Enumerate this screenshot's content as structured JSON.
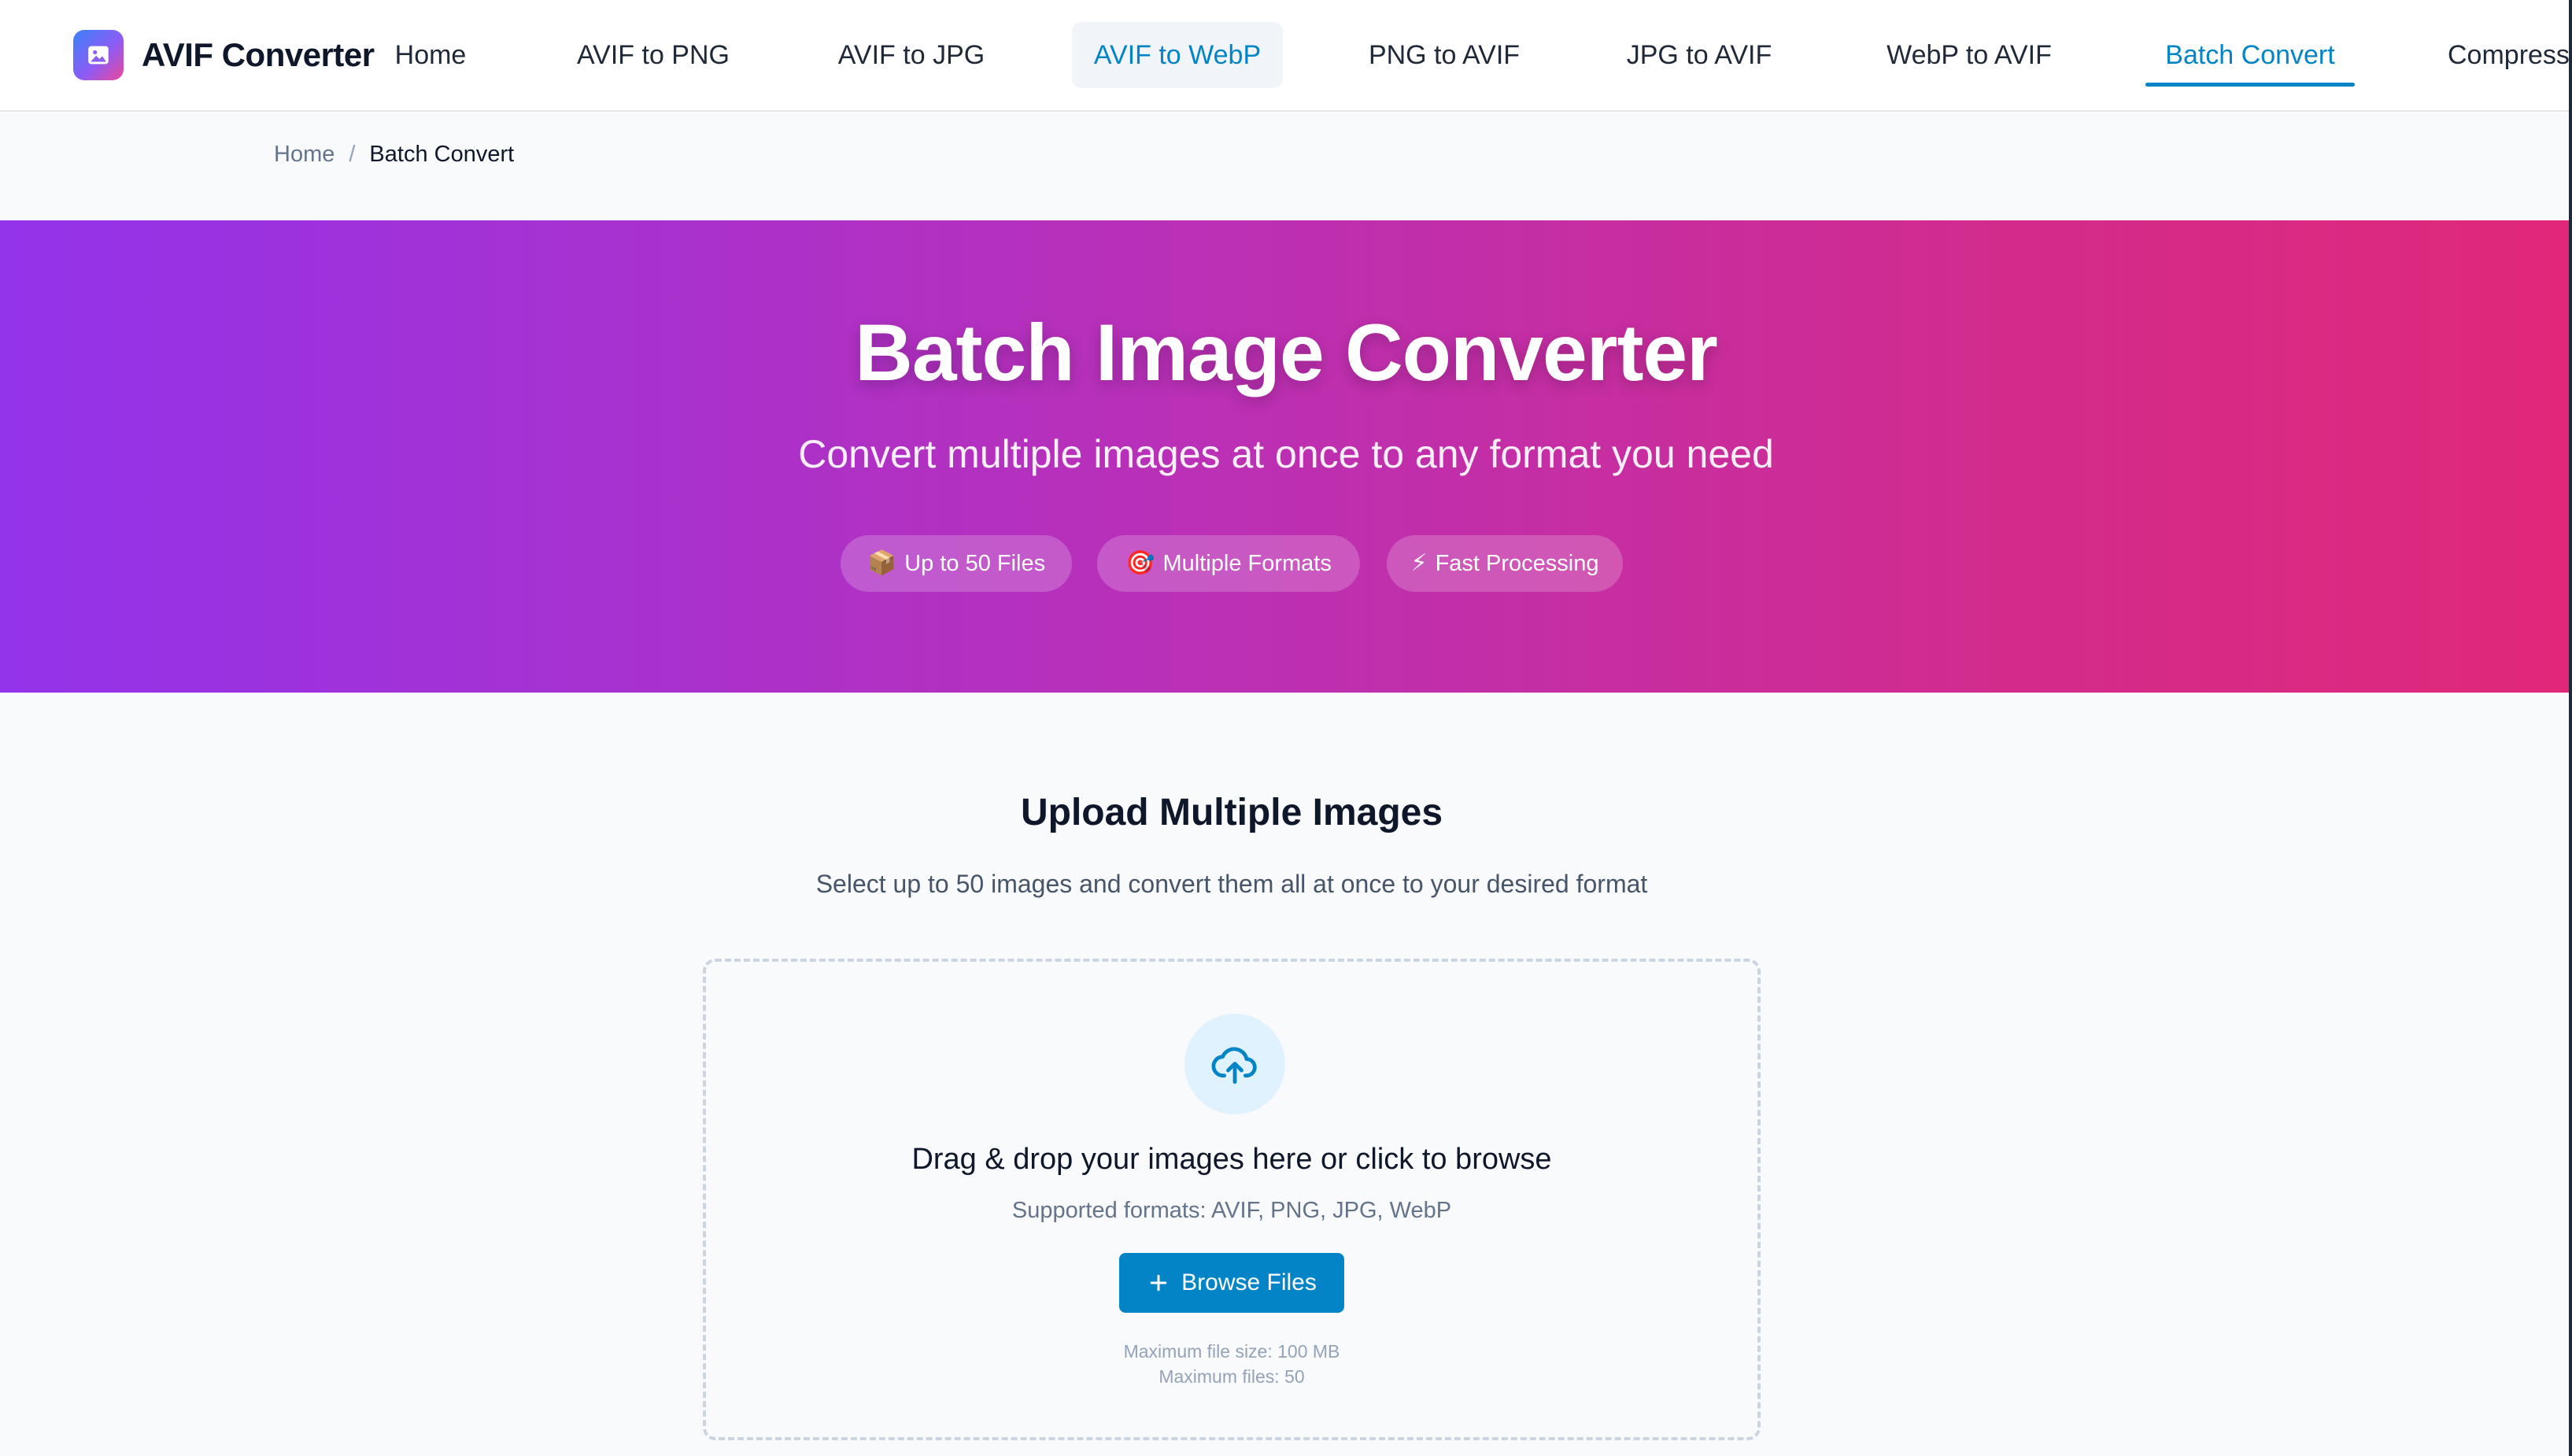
{
  "brand": {
    "name": "AVIF Converter",
    "logo_icon": "image-icon",
    "logo_gradient": [
      "#3b82f6",
      "#8b5cf6",
      "#ec4899"
    ]
  },
  "nav": {
    "items": [
      {
        "label": "Home"
      },
      {
        "label": "AVIF to PNG"
      },
      {
        "label": "AVIF to JPG"
      },
      {
        "label": "AVIF to WebP"
      },
      {
        "label": "PNG to AVIF"
      },
      {
        "label": "JPG to AVIF"
      },
      {
        "label": "WebP to AVIF"
      },
      {
        "label": "Batch Convert"
      },
      {
        "label": "Compress"
      }
    ],
    "hovered": "AVIF to WebP",
    "active": "Batch Convert",
    "accent_color": "#0284c7"
  },
  "breadcrumb": {
    "home": "Home",
    "separator": "/",
    "current": "Batch Convert"
  },
  "hero": {
    "title": "Batch Image Converter",
    "subtitle": "Convert multiple images at once to any format you need",
    "gradient": [
      "#9333ea",
      "#e0287a"
    ],
    "features": [
      {
        "icon": "📦",
        "label": "Up to 50 Files"
      },
      {
        "icon": "🎯",
        "label": "Multiple Formats"
      },
      {
        "icon": "⚡",
        "label": "Fast Processing"
      }
    ]
  },
  "upload": {
    "title": "Upload Multiple Images",
    "subtitle": "Select up to 50 images and convert them all at once to your desired format",
    "dropzone": {
      "icon": "cloud-upload-icon",
      "title": "Drag & drop your images here or click to browse",
      "formats": "Supported formats: AVIF, PNG, JPG, WebP",
      "button_label": "Browse Files",
      "button_icon": "plus-icon",
      "max_size": "Maximum file size: 100 MB",
      "max_files": "Maximum files: 50"
    }
  }
}
